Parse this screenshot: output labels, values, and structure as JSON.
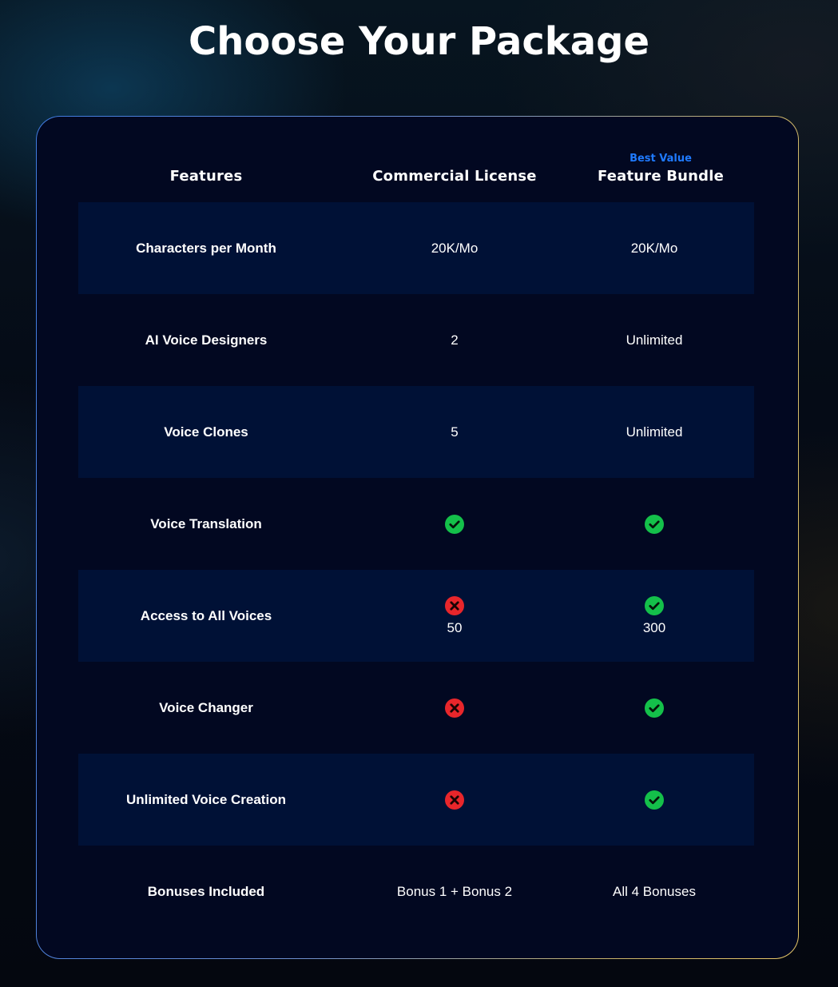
{
  "title": "Choose Your Package",
  "header": {
    "features_label": "Features",
    "commercial_label": "Commercial License",
    "bundle_badge": "Best Value",
    "bundle_label": "Feature Bundle"
  },
  "rows": [
    {
      "feature": "Characters per Month",
      "commercial": "20K/Mo",
      "bundle": "20K/Mo"
    },
    {
      "feature": "AI Voice Designers",
      "commercial": "2",
      "bundle": "Unlimited"
    },
    {
      "feature": "Voice Clones",
      "commercial": "5",
      "bundle": "Unlimited"
    },
    {
      "feature": "Voice Translation",
      "commercial_icon": "check-icon",
      "bundle_icon": "check-icon"
    },
    {
      "feature": "Access to All Voices",
      "commercial_icon": "cross-icon",
      "commercial": "50",
      "bundle_icon": "check-icon",
      "bundle": "300"
    },
    {
      "feature": "Voice Changer",
      "commercial_icon": "cross-icon",
      "bundle_icon": "check-icon"
    },
    {
      "feature": "Unlimited Voice Creation",
      "commercial_icon": "cross-icon",
      "bundle_icon": "check-icon"
    },
    {
      "feature": "Bonuses Included",
      "commercial": "Bonus 1 + Bonus 2",
      "bundle": "All 4 Bonuses"
    }
  ],
  "colors": {
    "check": "#14c04a",
    "cross": "#e8262b",
    "accent": "#1f7aff",
    "row_alt": "#001136",
    "card": "#020821"
  }
}
